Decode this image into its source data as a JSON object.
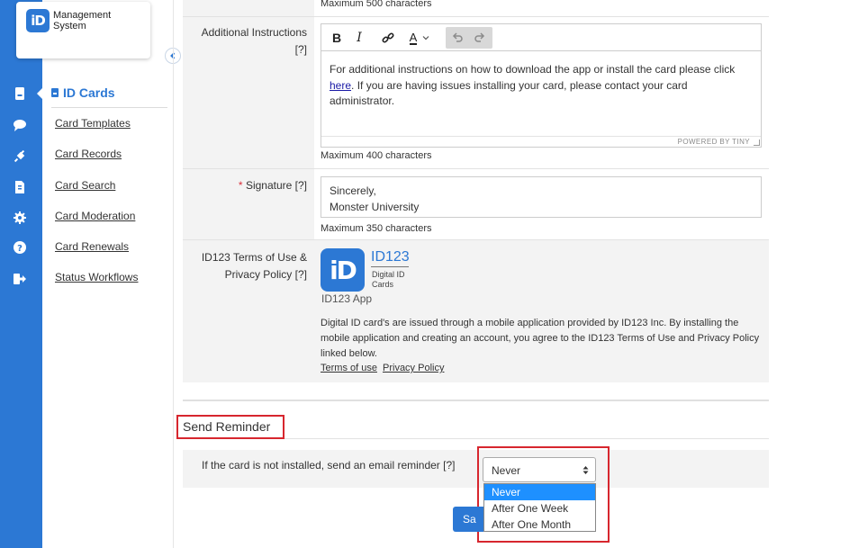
{
  "app": {
    "logo_letters": "iD",
    "name_line1": "Management",
    "name_line2": "System"
  },
  "rail": {
    "items": [
      {
        "icon": "id-card-icon"
      },
      {
        "icon": "chat-icon"
      },
      {
        "icon": "plug-icon"
      },
      {
        "icon": "document-icon"
      },
      {
        "icon": "gear-icon"
      },
      {
        "icon": "help-icon"
      },
      {
        "icon": "logout-icon"
      }
    ]
  },
  "submenu": {
    "title": "ID Cards",
    "items": [
      {
        "label": "Card Templates"
      },
      {
        "label": "Card Records"
      },
      {
        "label": "Card Search"
      },
      {
        "label": "Card Moderation"
      },
      {
        "label": "Card Renewals"
      },
      {
        "label": "Status Workflows"
      }
    ]
  },
  "form": {
    "top_hint": "Maximum 500 characters",
    "additional_instructions": {
      "label": "Additional Instructions",
      "help": "[?]",
      "toolbar": {
        "bold": "B",
        "italic": "I",
        "text_color": "A"
      },
      "text_before_link": "For additional instructions on how to download the app or install the card please click ",
      "link_text": "here",
      "text_after_link": ". If you are having issues installing your card, please contact your card administrator.",
      "powered_by": "POWERED BY TINY",
      "hint": "Maximum 400 characters"
    },
    "signature": {
      "required_mark": "*",
      "label": "Signature",
      "help": "[?]",
      "value": "Sincerely,\nMonster University",
      "hint": "Maximum 350 characters"
    },
    "terms": {
      "label_line1": "ID123 Terms of Use &",
      "label_line2": "Privacy Policy",
      "help": "[?]",
      "icon_letters": "iD",
      "brand": "ID123",
      "brand_sub_line1": "Digital ID",
      "brand_sub_line2": "Cards",
      "app_name": "ID123 App",
      "description": "Digital ID card's are issued through a mobile application provided by ID123 Inc. By installing the mobile application and creating an account, you agree to the ID123 Terms of Use and Privacy Policy linked below.",
      "terms_link": "Terms of use",
      "privacy_link": "Privacy Policy"
    }
  },
  "reminder": {
    "section_title": "Send Reminder",
    "label": "If the card is not installed, send an email reminder",
    "help": "[?]",
    "selected": "Never",
    "options": [
      "Never",
      "After One Week",
      "After One Month"
    ]
  },
  "actions": {
    "save_label_visible": "Sa"
  },
  "colors": {
    "brand_blue": "#2c78d4",
    "highlight_red": "#d7262e",
    "option_selected": "#1e90ff"
  }
}
